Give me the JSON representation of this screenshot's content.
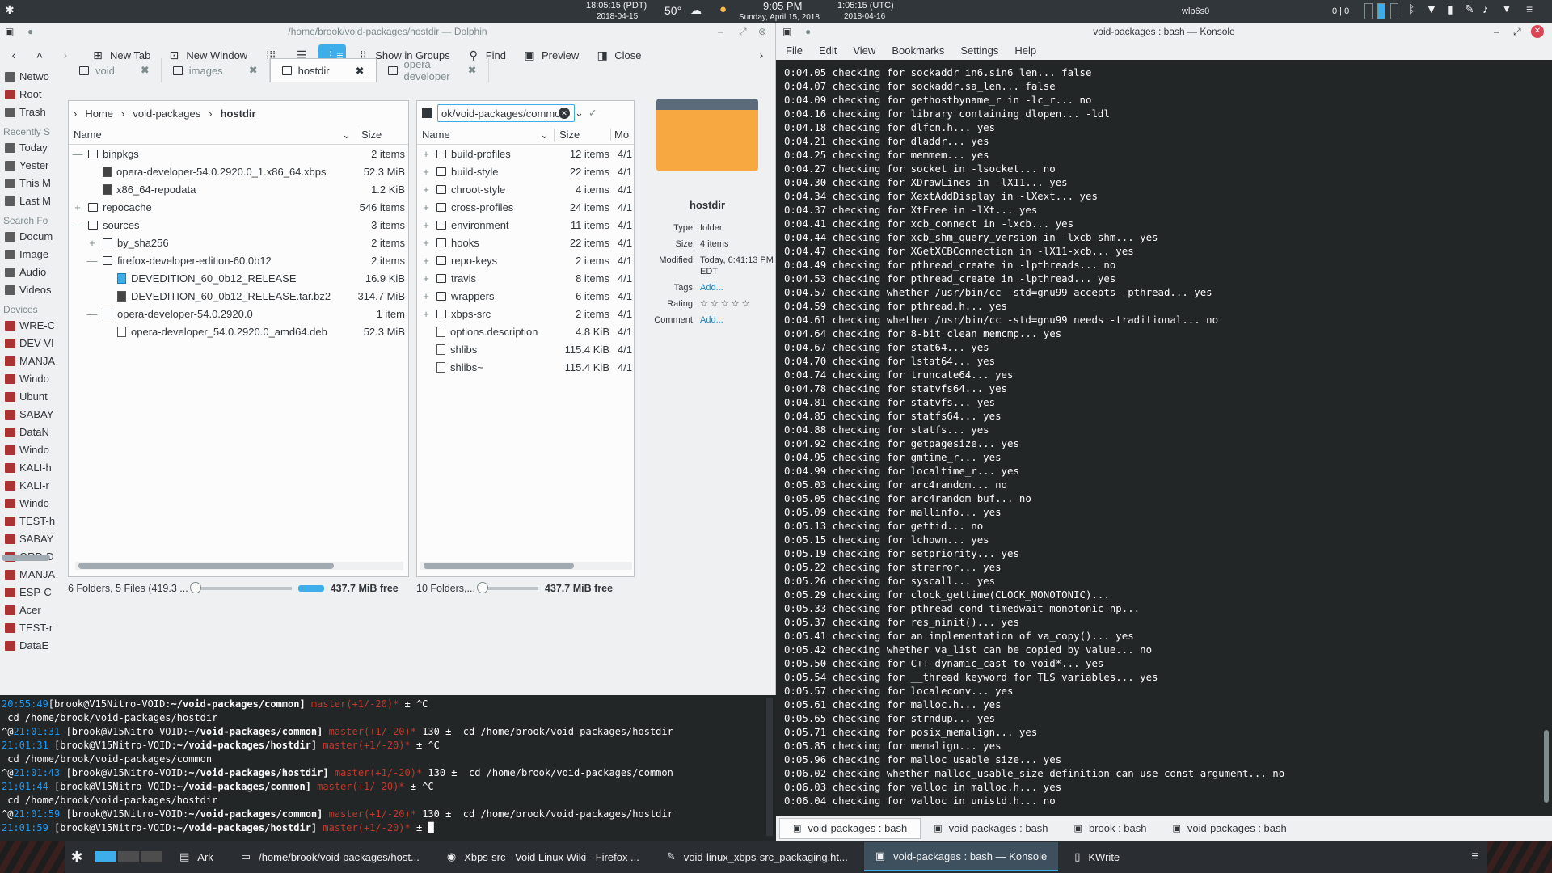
{
  "toppanel": {
    "time_pdt": "18:05:15",
    "tz_pdt": "(PDT)",
    "date_pdt": "2018-04-15",
    "temp": "50°",
    "time_local": "9:05 PM",
    "date_local": "Sunday, April 15, 2018",
    "time_utc": "1:05:15",
    "tz_utc": "(UTC)",
    "date_utc": "2018-04-16",
    "network": "wlp6s0",
    "counter": "0 | 0"
  },
  "dolphin": {
    "title": "/home/brook/void-packages/hostdir — Dolphin",
    "toolbar": {
      "new_tab": "New Tab",
      "new_window": "New Window",
      "show_groups": "Show in Groups",
      "find": "Find",
      "preview": "Preview",
      "close": "Close"
    },
    "tabs": [
      {
        "label": "void"
      },
      {
        "label": "images"
      },
      {
        "label": "hostdir"
      },
      {
        "label": "opera-developer"
      }
    ],
    "places": {
      "top": [
        "Netwo",
        "Root",
        "Trash"
      ],
      "recent_header": "Recently S",
      "recent": [
        "Today",
        "Yester",
        "This M",
        "Last M"
      ],
      "search_header": "Search Fo",
      "search": [
        "Docum",
        "Image",
        "Audio",
        "Videos"
      ],
      "devices_header": "Devices",
      "devices": [
        "WRE-C",
        "DEV-VI",
        "MANJA",
        "Windo",
        "Ubunt",
        "SABAY",
        "DataN",
        "Windo",
        "KALI-h",
        "KALI-r",
        "Windo",
        "TEST-h",
        "SABAY",
        "ORD-D",
        "MANJA",
        "ESP-C",
        "Acer",
        "TEST-r",
        "DataE"
      ]
    },
    "left": {
      "crumbs": [
        "Home",
        "void-packages",
        "hostdir"
      ],
      "col_name": "Name",
      "col_size": "Size",
      "rows": [
        {
          "name": "binpkgs",
          "size": "2 items",
          "indent": 0,
          "kind": "folder",
          "exp": "—"
        },
        {
          "name": "opera-developer-54.0.2920.0_1.x86_64.xbps",
          "size": "52.3 MiB",
          "indent": 1,
          "kind": "dark",
          "exp": ""
        },
        {
          "name": "x86_64-repodata",
          "size": "1.2 KiB",
          "indent": 1,
          "kind": "dark",
          "exp": ""
        },
        {
          "name": "repocache",
          "size": "546 items",
          "indent": 0,
          "kind": "folder",
          "exp": "+"
        },
        {
          "name": "sources",
          "size": "3 items",
          "indent": 0,
          "kind": "folder",
          "exp": "—"
        },
        {
          "name": "by_sha256",
          "size": "2 items",
          "indent": 1,
          "kind": "folder",
          "exp": "+"
        },
        {
          "name": "firefox-developer-edition-60.0b12",
          "size": "2 items",
          "indent": 1,
          "kind": "folder",
          "exp": "—"
        },
        {
          "name": "DEVEDITION_60_0b12_RELEASE",
          "size": "16.9 KiB",
          "indent": 2,
          "kind": "blue",
          "exp": ""
        },
        {
          "name": "DEVEDITION_60_0b12_RELEASE.tar.bz2",
          "size": "314.7 MiB",
          "indent": 2,
          "kind": "dark",
          "exp": ""
        },
        {
          "name": "opera-developer-54.0.2920.0",
          "size": "1 item",
          "indent": 1,
          "kind": "folder",
          "exp": "—"
        },
        {
          "name": "opera-developer_54.0.2920.0_amd64.deb",
          "size": "52.3 MiB",
          "indent": 2,
          "kind": "file",
          "exp": ""
        }
      ],
      "status": "6 Folders, 5 Files (419.3 ...",
      "free": "437.7 MiB free"
    },
    "right": {
      "path": "ok/void-packages/common/",
      "col_name": "Name",
      "col_size": "Size",
      "col_mod": "Mo",
      "rows": [
        {
          "name": "build-profiles",
          "size": "12 items",
          "mod": "4/1",
          "kind": "folder",
          "exp": "+"
        },
        {
          "name": "build-style",
          "size": "22 items",
          "mod": "4/1",
          "kind": "folder",
          "exp": "+"
        },
        {
          "name": "chroot-style",
          "size": "4 items",
          "mod": "4/1",
          "kind": "folder",
          "exp": "+"
        },
        {
          "name": "cross-profiles",
          "size": "24 items",
          "mod": "4/1",
          "kind": "folder",
          "exp": "+"
        },
        {
          "name": "environment",
          "size": "11 items",
          "mod": "4/1",
          "kind": "folder",
          "exp": "+"
        },
        {
          "name": "hooks",
          "size": "22 items",
          "mod": "4/1",
          "kind": "folder",
          "exp": "+"
        },
        {
          "name": "repo-keys",
          "size": "2 items",
          "mod": "4/1",
          "kind": "folder",
          "exp": "+"
        },
        {
          "name": "travis",
          "size": "8 items",
          "mod": "4/1",
          "kind": "folder",
          "exp": "+"
        },
        {
          "name": "wrappers",
          "size": "6 items",
          "mod": "4/1",
          "kind": "folder",
          "exp": "+"
        },
        {
          "name": "xbps-src",
          "size": "2 items",
          "mod": "4/1",
          "kind": "folder",
          "exp": "+"
        },
        {
          "name": "options.description",
          "size": "4.8 KiB",
          "mod": "4/1",
          "kind": "file",
          "exp": ""
        },
        {
          "name": "shlibs",
          "size": "115.4 KiB",
          "mod": "4/1",
          "kind": "file",
          "exp": ""
        },
        {
          "name": "shlibs~",
          "size": "115.4 KiB",
          "mod": "4/1",
          "kind": "file",
          "exp": ""
        }
      ],
      "status": "10 Folders,...",
      "free": "437.7 MiB free"
    },
    "info": {
      "name": "hostdir",
      "type_k": "Type:",
      "type_v": "folder",
      "size_k": "Size:",
      "size_v": "4 items",
      "mod_k": "Modified:",
      "mod_v": "Today, 6:41:13 PM",
      "mod_v2": "EDT",
      "tags_k": "Tags:",
      "tags_v": "Add...",
      "rating_k": "Rating:",
      "rating_v": "☆☆☆☆☆",
      "comment_k": "Comment:",
      "comment_v": "Add..."
    }
  },
  "term1": {
    "lines": [
      {
        "time": "20:55:49",
        "user": "[brook@V15Nitro-VOID:",
        "path": "~/void-packages/common]",
        "branch": " master(+1/-20)*",
        "rest": " ± ^C"
      },
      {
        "plain": " cd /home/brook/void-packages/hostdir"
      },
      {
        "pre": "^@",
        "time": "21:01:31",
        "user": " [brook@V15Nitro-VOID:",
        "path": "~/void-packages/common]",
        "branch": " master(+1/-20)*",
        "rest": " 130 ±  cd /home/brook/void-packages/hostdir"
      },
      {
        "time": "21:01:31",
        "user": " [brook@V15Nitro-VOID:",
        "path": "~/void-packages/hostdir]",
        "branch": " master(+1/-20)*",
        "rest": " ± ^C"
      },
      {
        "plain": " cd /home/brook/void-packages/common"
      },
      {
        "pre": "^@",
        "time": "21:01:43",
        "user": " [brook@V15Nitro-VOID:",
        "path": "~/void-packages/hostdir]",
        "branch": " master(+1/-20)*",
        "rest": " 130 ±  cd /home/brook/void-packages/common"
      },
      {
        "time": "21:01:44",
        "user": " [brook@V15Nitro-VOID:",
        "path": "~/void-packages/common]",
        "branch": " master(+1/-20)*",
        "rest": " ± ^C"
      },
      {
        "plain": " cd /home/brook/void-packages/hostdir"
      },
      {
        "pre": "^@",
        "time": "21:01:59",
        "user": " [brook@V15Nitro-VOID:",
        "path": "~/void-packages/common]",
        "branch": " master(+1/-20)*",
        "rest": " 130 ±  cd /home/brook/void-packages/hostdir"
      },
      {
        "time": "21:01:59",
        "user": " [brook@V15Nitro-VOID:",
        "path": "~/void-packages/hostdir]",
        "branch": " master(+1/-20)*",
        "rest": " ± █"
      }
    ]
  },
  "konsole": {
    "title": "void-packages : bash — Konsole",
    "menu": [
      "File",
      "Edit",
      "View",
      "Bookmarks",
      "Settings",
      "Help"
    ],
    "lines": [
      "0:04.05 checking for sockaddr_in6.sin6_len... false",
      "0:04.07 checking for sockaddr.sa_len... false",
      "0:04.09 checking for gethostbyname_r in -lc_r... no",
      "0:04.16 checking for library containing dlopen... -ldl",
      "0:04.18 checking for dlfcn.h... yes",
      "0:04.21 checking for dladdr... yes",
      "0:04.25 checking for memmem... yes",
      "0:04.27 checking for socket in -lsocket... no",
      "0:04.30 checking for XDrawLines in -lX11... yes",
      "0:04.34 checking for XextAddDisplay in -lXext... yes",
      "0:04.37 checking for XtFree in -lXt... yes",
      "0:04.41 checking for xcb_connect in -lxcb... yes",
      "0:04.44 checking for xcb_shm_query_version in -lxcb-shm... yes",
      "0:04.47 checking for XGetXCBConnection in -lX11-xcb... yes",
      "0:04.49 checking for pthread_create in -lpthreads... no",
      "0:04.53 checking for pthread_create in -lpthread... yes",
      "0:04.57 checking whether /usr/bin/cc -std=gnu99 accepts -pthread... yes",
      "0:04.59 checking for pthread.h... yes",
      "0:04.61 checking whether /usr/bin/cc -std=gnu99 needs -traditional... no",
      "0:04.64 checking for 8-bit clean memcmp... yes",
      "0:04.67 checking for stat64... yes",
      "0:04.70 checking for lstat64... yes",
      "0:04.74 checking for truncate64... yes",
      "0:04.78 checking for statvfs64... yes",
      "0:04.81 checking for statvfs... yes",
      "0:04.85 checking for statfs64... yes",
      "0:04.88 checking for statfs... yes",
      "0:04.92 checking for getpagesize... yes",
      "0:04.95 checking for gmtime_r... yes",
      "0:04.99 checking for localtime_r... yes",
      "0:05.03 checking for arc4random... no",
      "0:05.05 checking for arc4random_buf... no",
      "0:05.09 checking for mallinfo... yes",
      "0:05.13 checking for gettid... no",
      "0:05.15 checking for lchown... yes",
      "0:05.19 checking for setpriority... yes",
      "0:05.22 checking for strerror... yes",
      "0:05.26 checking for syscall... yes",
      "0:05.29 checking for clock_gettime(CLOCK_MONOTONIC)...",
      "0:05.33 checking for pthread_cond_timedwait_monotonic_np...",
      "0:05.37 checking for res_ninit()... yes",
      "0:05.41 checking for an implementation of va_copy()... yes",
      "0:05.42 checking whether va_list can be copied by value... no",
      "0:05.50 checking for C++ dynamic_cast to void*... yes",
      "0:05.54 checking for __thread keyword for TLS variables... yes",
      "0:05.57 checking for localeconv... yes",
      "0:05.61 checking for malloc.h... yes",
      "0:05.65 checking for strndup... yes",
      "0:05.71 checking for posix_memalign... yes",
      "0:05.85 checking for memalign... yes",
      "0:05.96 checking for malloc_usable_size... yes",
      "0:06.02 checking whether malloc_usable_size definition can use const argument... no",
      "0:06.03 checking for valloc in malloc.h... yes",
      "0:06.04 checking for valloc in unistd.h... no"
    ],
    "tabs": [
      "void-packages : bash",
      "void-packages : bash",
      "brook : bash",
      "void-packages : bash"
    ]
  },
  "taskbar": {
    "tasks": [
      "Ark",
      "/home/brook/void-packages/host...",
      "Xbps-src - Void Linux Wiki - Firefox ...",
      "void-linux_xbps-src_packaging.ht...",
      "void-packages : bash — Konsole",
      "KWrite"
    ]
  }
}
